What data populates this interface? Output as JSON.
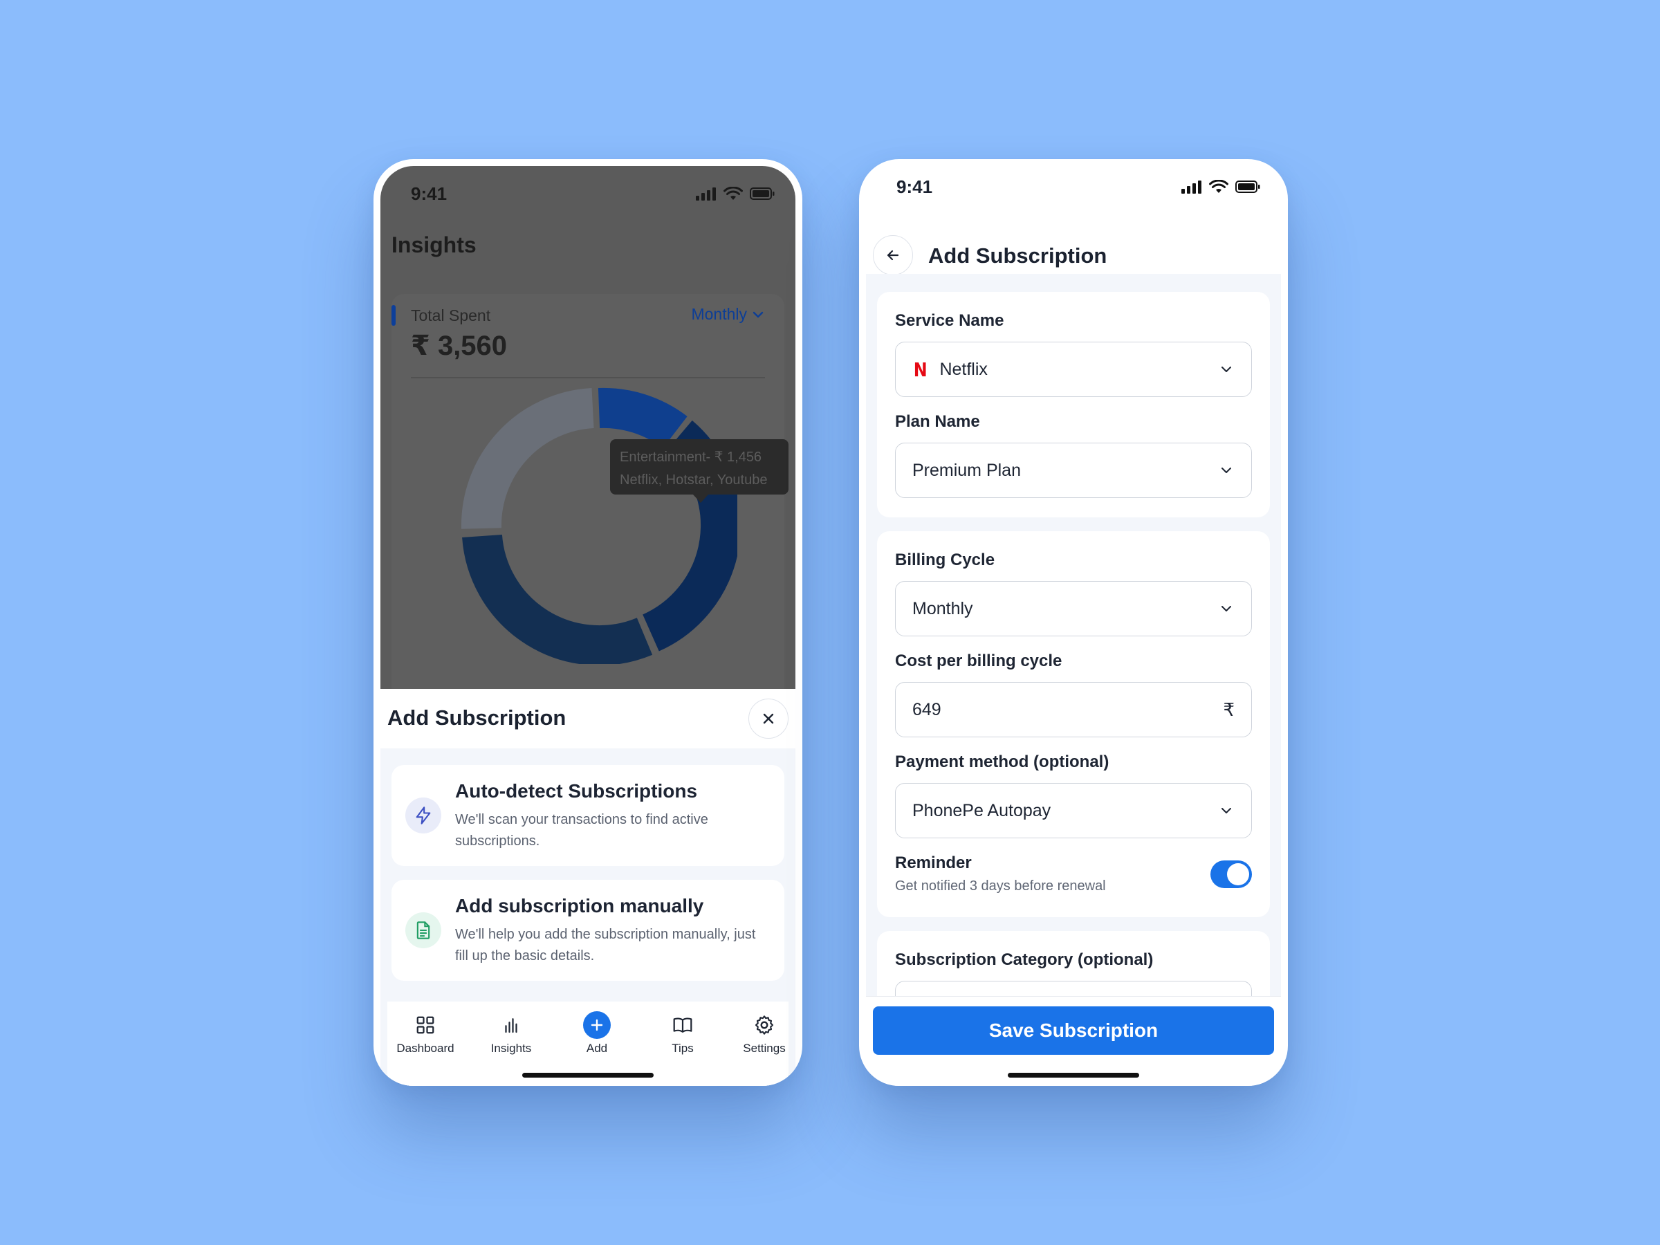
{
  "status_bar": {
    "time": "9:41"
  },
  "left_screen": {
    "page_title": "Insights",
    "total_card": {
      "label": "Total Spent",
      "value": "₹ 3,560",
      "period": "Monthly"
    },
    "tooltip": {
      "line1": "Entertainment- ₹ 1,456",
      "line2": "Netflix, Hotstar, Youtube"
    },
    "sheet": {
      "title": "Add Subscription",
      "options": [
        {
          "title": "Auto-detect Subscriptions",
          "description": "We'll scan your transactions to find active subscriptions.",
          "icon": "lightning-icon"
        },
        {
          "title": "Add subscription manually",
          "description": "We'll help you add the subscription manually, just fill up the basic details.",
          "icon": "document-icon"
        }
      ]
    },
    "nav": [
      {
        "label": "Dashboard",
        "icon": "grid-icon"
      },
      {
        "label": "Insights",
        "icon": "bar-chart-icon"
      },
      {
        "label": "Add",
        "icon": "plus-icon"
      },
      {
        "label": "Tips",
        "icon": "book-icon"
      },
      {
        "label": "Settings",
        "icon": "gear-icon"
      }
    ]
  },
  "right_screen": {
    "title": "Add Subscription",
    "service": {
      "label": "Service Name",
      "value": "Netflix",
      "logo": "N"
    },
    "plan": {
      "label": "Plan Name",
      "value": "Premium Plan"
    },
    "billing": {
      "label": "Billing Cycle",
      "value": "Monthly"
    },
    "cost": {
      "label": "Cost per billing cycle",
      "value": "649",
      "currency": "₹"
    },
    "payment": {
      "label": "Payment method (optional)",
      "value": "PhonePe Autopay"
    },
    "reminder": {
      "label": "Reminder",
      "sub": "Get notified 3 days before renewal",
      "enabled": true
    },
    "category": {
      "label": "Subscription Category (optional)"
    },
    "save_label": "Save Subscription"
  },
  "colors": {
    "background": "#8bbcfc",
    "primary": "#1a73e8",
    "netflix": "#e50914"
  }
}
